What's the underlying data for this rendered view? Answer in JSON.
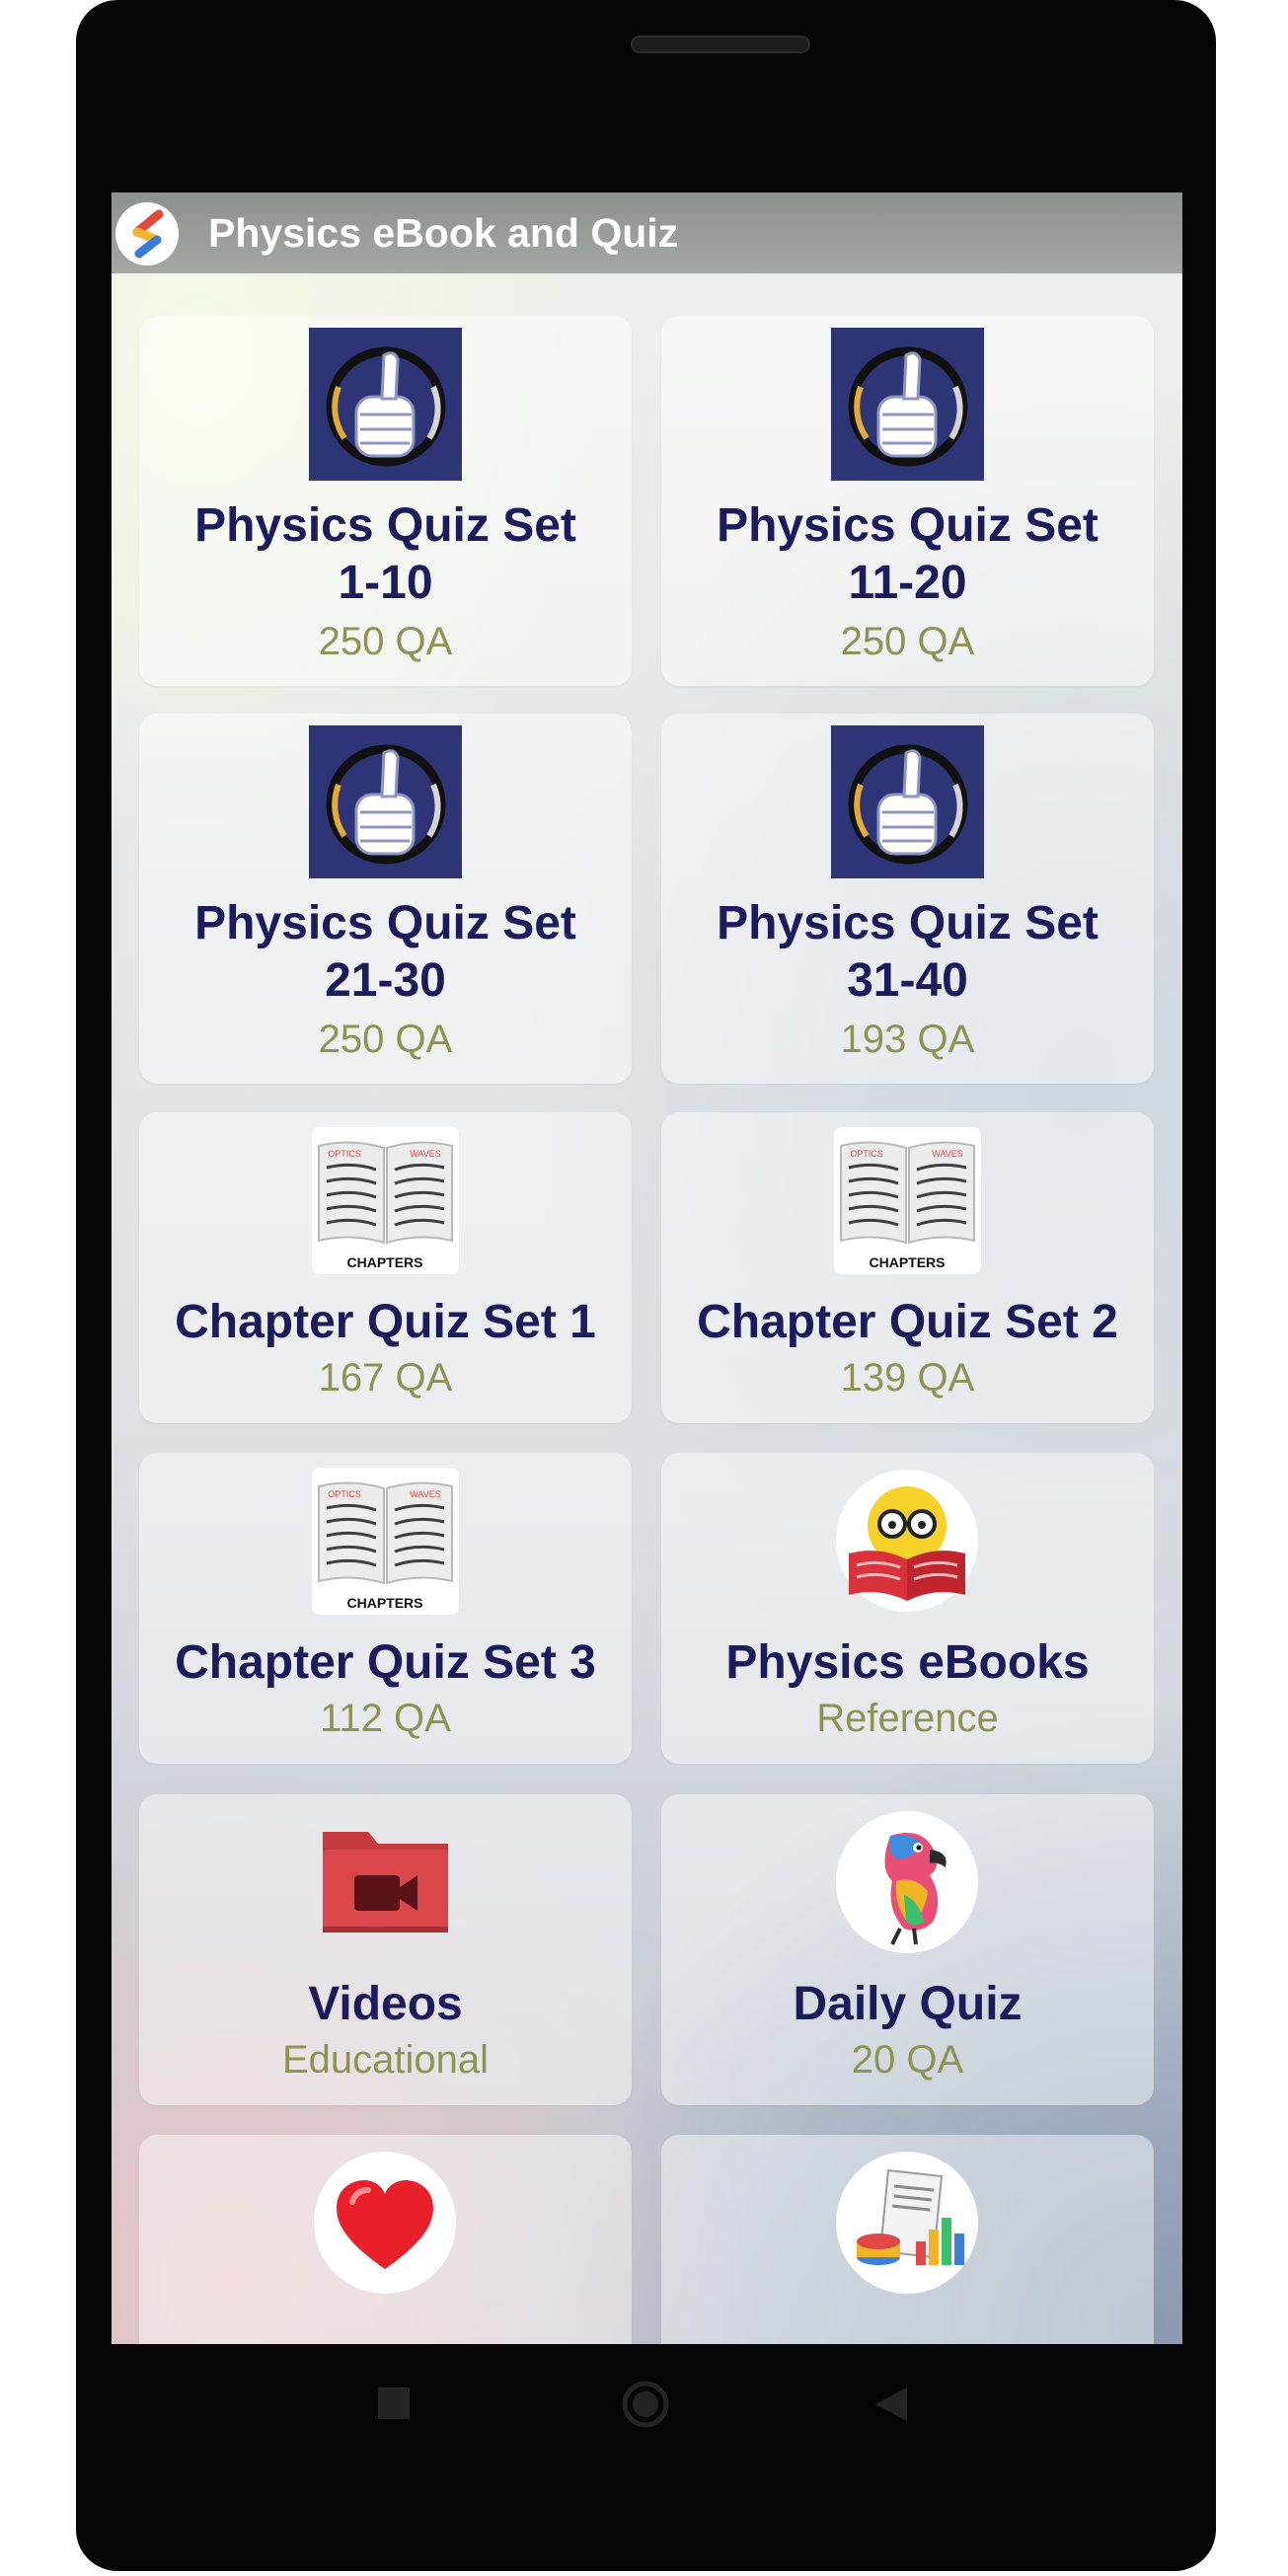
{
  "app": {
    "title": "Physics eBook and Quiz",
    "logo_icon": "s-logo-icon"
  },
  "colors": {
    "appbar": "#999e99",
    "card_title": "#1c1b5c",
    "card_subtitle": "#8d9453",
    "quiz_icon_bg": "#2e3576",
    "folder_red": "#d9474b"
  },
  "cards": [
    {
      "title_line1": "Physics Quiz Set",
      "title_line2": "1-10",
      "subtitle": "250 QA",
      "icon": "thumbs-up-icon"
    },
    {
      "title_line1": "Physics Quiz Set",
      "title_line2": "11-20",
      "subtitle": "250 QA",
      "icon": "thumbs-up-icon"
    },
    {
      "title_line1": "Physics Quiz Set",
      "title_line2": "21-30",
      "subtitle": "250 QA",
      "icon": "thumbs-up-icon"
    },
    {
      "title_line1": "Physics Quiz Set",
      "title_line2": "31-40",
      "subtitle": "193 QA",
      "icon": "thumbs-up-icon"
    },
    {
      "title": "Chapter Quiz Set 1",
      "subtitle": "167 QA",
      "icon": "chapters-book-icon",
      "icon_label": "CHAPTERS",
      "page_left": "OPTICS",
      "page_right": "WAVES"
    },
    {
      "title": "Chapter Quiz Set 2",
      "subtitle": "139 QA",
      "icon": "chapters-book-icon",
      "icon_label": "CHAPTERS",
      "page_left": "OPTICS",
      "page_right": "WAVES"
    },
    {
      "title": "Chapter Quiz Set 3",
      "subtitle": "112 QA",
      "icon": "chapters-book-icon",
      "icon_label": "CHAPTERS",
      "page_left": "OPTICS",
      "page_right": "WAVES"
    },
    {
      "title": "Physics eBooks",
      "subtitle": "Reference",
      "icon": "reading-emoji-icon"
    },
    {
      "title": "Videos",
      "subtitle": "Educational",
      "icon": "video-folder-icon"
    },
    {
      "title": "Daily Quiz",
      "subtitle": "20 QA",
      "icon": "parrot-icon"
    },
    {
      "icon": "heart-icon"
    },
    {
      "icon": "report-chart-icon"
    }
  ],
  "navbar": {
    "recents_icon": "square-icon",
    "home_icon": "circle-icon",
    "back_icon": "triangle-back-icon"
  }
}
